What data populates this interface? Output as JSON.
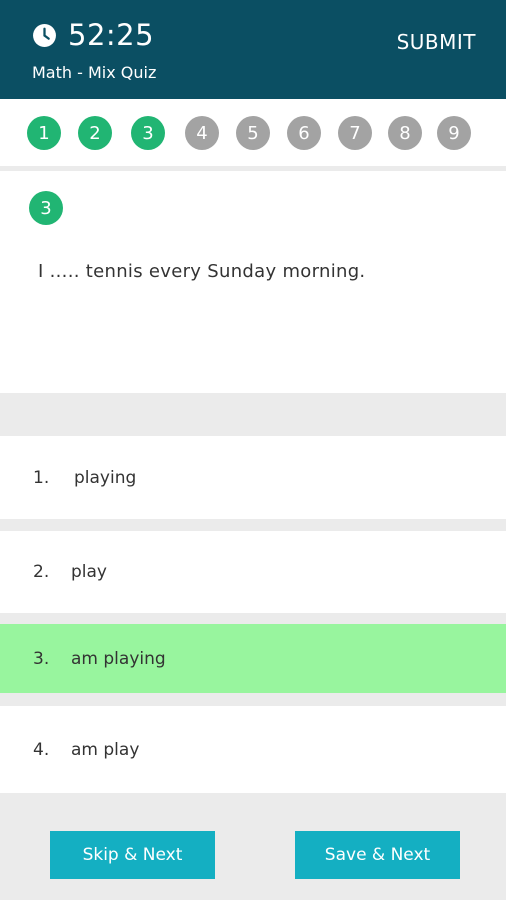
{
  "header": {
    "timer": "52:25",
    "quiz_title": "Math - Mix Quiz",
    "submit_label": "SUBMIT"
  },
  "question_nav": [
    {
      "number": "1",
      "state": "answered"
    },
    {
      "number": "2",
      "state": "answered"
    },
    {
      "number": "3",
      "state": "answered"
    },
    {
      "number": "4",
      "state": "unanswered"
    },
    {
      "number": "5",
      "state": "unanswered"
    },
    {
      "number": "6",
      "state": "unanswered"
    },
    {
      "number": "7",
      "state": "unanswered"
    },
    {
      "number": "8",
      "state": "unanswered"
    },
    {
      "number": "9",
      "state": "unanswered"
    }
  ],
  "question": {
    "number": "3",
    "text": "I ..... tennis every Sunday morning."
  },
  "options": [
    {
      "number": "1.",
      "text": "playing",
      "selected": false
    },
    {
      "number": "2.",
      "text": "play",
      "selected": false
    },
    {
      "number": "3.",
      "text": "am playing",
      "selected": true
    },
    {
      "number": "4.",
      "text": "am play",
      "selected": false
    }
  ],
  "buttons": {
    "skip_label": "Skip & Next",
    "save_label": "Save & Next"
  },
  "colors": {
    "header_bg": "#0b4f63",
    "answered": "#21b573",
    "unanswered": "#a3a3a3",
    "selected_option": "#98f59e",
    "button": "#14afc2"
  }
}
